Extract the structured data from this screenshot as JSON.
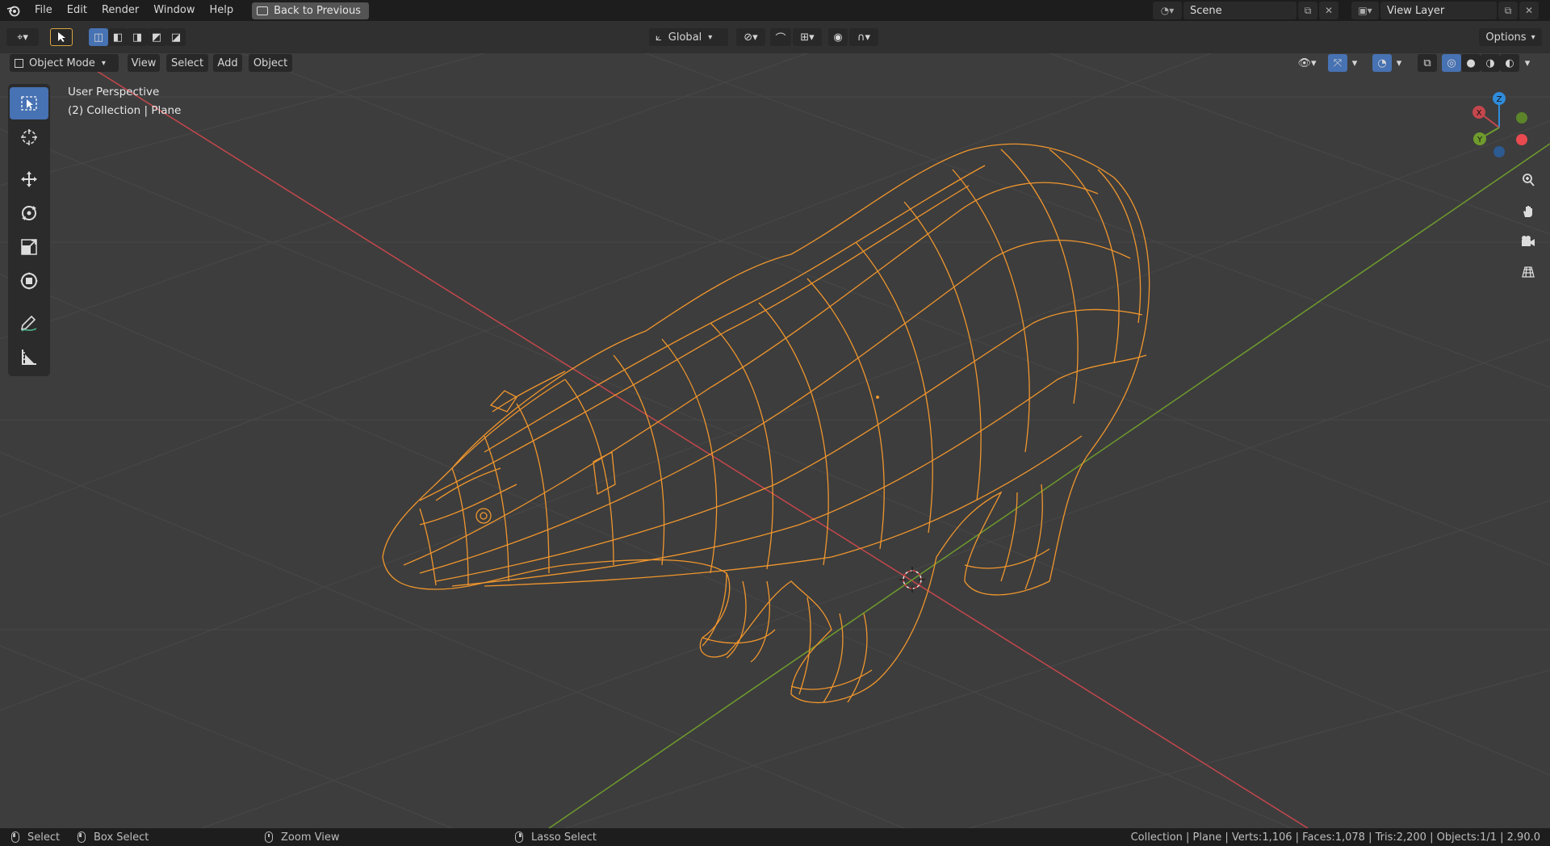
{
  "menu": {
    "file": "File",
    "edit": "Edit",
    "render": "Render",
    "window": "Window",
    "help": "Help",
    "back": "Back to Previous"
  },
  "scene": {
    "name": "Scene",
    "view_layer": "View Layer"
  },
  "toolbar": {
    "orientation": "Global",
    "options": "Options"
  },
  "header": {
    "mode": "Object Mode",
    "view": "View",
    "select": "Select",
    "add": "Add",
    "object": "Object"
  },
  "viewport": {
    "perspective": "User Perspective",
    "collection": "(2) Collection | Plane"
  },
  "gizmo": {
    "x": "X",
    "y": "Y",
    "z": "Z"
  },
  "status": {
    "select": "Select",
    "box_select": "Box Select",
    "zoom_view": "Zoom View",
    "lasso_select": "Lasso Select",
    "stats": "Collection | Plane | Verts:1,106 | Faces:1,078 | Tris:2,200 | Objects:1/1 | 2.90.0"
  },
  "colors": {
    "accent": "#4772b3",
    "wire": "#f0962d",
    "x_axis": "#c5474d",
    "y_axis": "#6f9b2d"
  }
}
